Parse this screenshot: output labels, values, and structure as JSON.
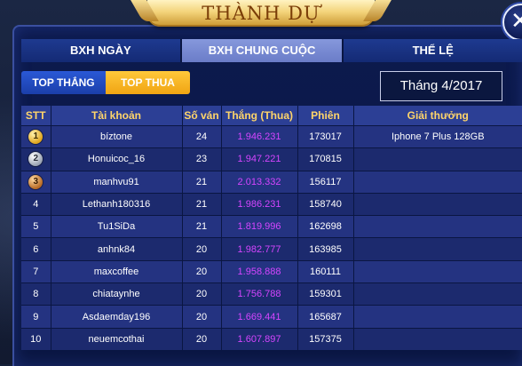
{
  "title": "THÀNH DỰ",
  "tabs": [
    {
      "label": "BXH NGÀY",
      "active": false
    },
    {
      "label": "BXH CHUNG CUỘC",
      "active": true
    },
    {
      "label": "THỂ LỆ",
      "active": false
    }
  ],
  "subtabs": [
    {
      "label": "TOP THẮNG",
      "active": false
    },
    {
      "label": "TOP THUA",
      "active": true
    }
  ],
  "month": "Tháng 4/2017",
  "columns": [
    "STT",
    "Tài khoản",
    "Số ván",
    "Thắng (Thua)",
    "Phiên",
    "Giải thưởng"
  ],
  "rows": [
    {
      "stt": "1",
      "medal": "gold",
      "account": "bíztone",
      "games": "24",
      "score": "1.946.231",
      "session": "173017",
      "prize": "Iphone 7 Plus 128GB"
    },
    {
      "stt": "2",
      "medal": "silver",
      "account": "Honuicoc_16",
      "games": "23",
      "score": "1.947.221",
      "session": "170815",
      "prize": ""
    },
    {
      "stt": "3",
      "medal": "bronze",
      "account": "manhvu91",
      "games": "21",
      "score": "2.013.332",
      "session": "156117",
      "prize": ""
    },
    {
      "stt": "4",
      "medal": "",
      "account": "Lethanh180316",
      "games": "21",
      "score": "1.986.231",
      "session": "158740",
      "prize": ""
    },
    {
      "stt": "5",
      "medal": "",
      "account": "Tu1SiDa",
      "games": "21",
      "score": "1.819.996",
      "session": "162698",
      "prize": ""
    },
    {
      "stt": "6",
      "medal": "",
      "account": "anhnk84",
      "games": "20",
      "score": "1.982.777",
      "session": "163985",
      "prize": ""
    },
    {
      "stt": "7",
      "medal": "",
      "account": "maxcoffee",
      "games": "20",
      "score": "1.958.888",
      "session": "160111",
      "prize": ""
    },
    {
      "stt": "8",
      "medal": "",
      "account": "chiataynhe",
      "games": "20",
      "score": "1.756.788",
      "session": "159301",
      "prize": ""
    },
    {
      "stt": "9",
      "medal": "",
      "account": "Asdaemday196",
      "games": "20",
      "score": "1.669.441",
      "session": "165687",
      "prize": ""
    },
    {
      "stt": "10",
      "medal": "",
      "account": "neuemcothai",
      "games": "20",
      "score": "1.607.897",
      "session": "157375",
      "prize": ""
    }
  ],
  "colors": {
    "gold_text": "#ffd56a",
    "score_text": "#d545ff",
    "active_subtab": "#f0a413"
  },
  "icons": {
    "close": "close-icon",
    "medal_gold": "gold-medal-icon",
    "medal_silver": "silver-medal-icon",
    "medal_bronze": "bronze-medal-icon"
  }
}
